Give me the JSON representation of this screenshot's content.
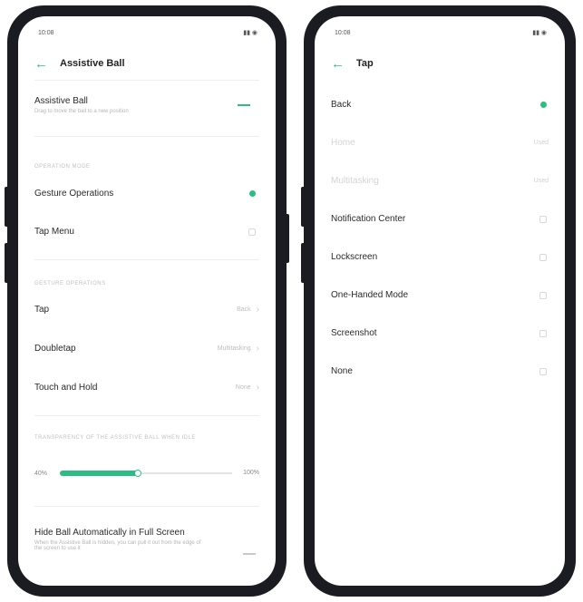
{
  "left_screen": {
    "status_time": "10:08",
    "header": {
      "back_icon": "back-arrow-icon",
      "title": "Assistive Ball"
    },
    "assistive_ball": {
      "label": "Assistive Ball",
      "subtitle": "Drag to move the ball to a new position",
      "enabled": true
    },
    "operation_section": "OPERATION MODE",
    "gesture_operations": {
      "label": "Gesture Operations",
      "selected": true
    },
    "tap_menu": {
      "label": "Tap Menu",
      "selected": false
    },
    "gesture_section": "GESTURE OPERATIONS",
    "gestures": [
      {
        "label": "Tap",
        "value": "Back"
      },
      {
        "label": "Doubletap",
        "value": "Multitasking"
      },
      {
        "label": "Touch and Hold",
        "value": "None"
      }
    ],
    "transparency_section": "TRANSPARENCY OF THE ASSISTIVE BALL WHEN IDLE",
    "slider": {
      "min_label": "40%",
      "max_label": "100%",
      "level": 0.45
    },
    "hide_ball": {
      "label": "Hide Ball Automatically in Full Screen",
      "subtitle": "When the Assistive Ball is hidden, you can pull it out from the edge of the screen to use it",
      "enabled": false
    }
  },
  "right_screen": {
    "status_time": "10:08",
    "header": {
      "back_icon": "back-arrow-icon",
      "title": "Tap"
    },
    "options": [
      {
        "label": "Back",
        "value": "",
        "selected": true,
        "disabled": false
      },
      {
        "label": "Home",
        "value": "Used",
        "selected": false,
        "disabled": true
      },
      {
        "label": "Multitasking",
        "value": "Used",
        "selected": false,
        "disabled": true
      },
      {
        "label": "Notification Center",
        "value": "",
        "selected": false,
        "disabled": false
      },
      {
        "label": "Lockscreen",
        "value": "",
        "selected": false,
        "disabled": false
      },
      {
        "label": "One-Handed Mode",
        "value": "",
        "selected": false,
        "disabled": false
      },
      {
        "label": "Screenshot",
        "value": "",
        "selected": false,
        "disabled": false
      },
      {
        "label": "None",
        "value": "",
        "selected": false,
        "disabled": false
      }
    ]
  },
  "colors": {
    "accent": "#2dbd83",
    "phone_frame": "#1b1c22",
    "divider": "#eeeeee"
  }
}
